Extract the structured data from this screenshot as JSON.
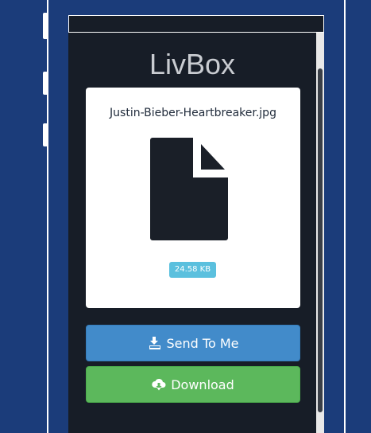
{
  "app": {
    "title": "LivBox"
  },
  "file": {
    "name": "Justin-Bieber-Heartbreaker.jpg",
    "size": "24.58 KB",
    "icon": "file-icon"
  },
  "actions": {
    "send_label": "Send To Me",
    "send_icon": "send-to-me-icon",
    "download_label": "Download",
    "download_icon": "cloud-download-icon"
  },
  "colors": {
    "background": "#1b3c7a",
    "screen": "#171d27",
    "send_button": "#428bca",
    "download_button": "#5cb85c",
    "size_badge": "#5bc0de"
  }
}
